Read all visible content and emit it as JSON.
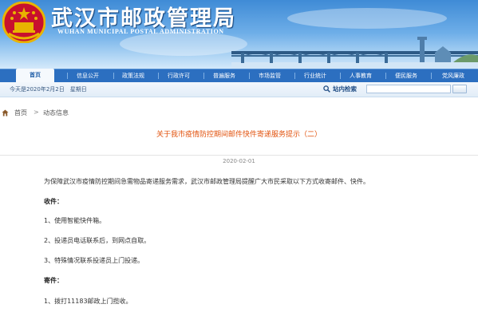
{
  "header": {
    "title_cn": "武汉市邮政管理局",
    "title_en": "WUHAN MUNICIPAL POSTAL ADMINISTRATION",
    "accent_color": "#2c6fc0"
  },
  "nav": {
    "items": [
      "首页",
      "信息公开",
      "政策法规",
      "行政许可",
      "普遍服务",
      "市场监管",
      "行业统计",
      "人事教育",
      "便民服务",
      "党风廉政"
    ],
    "active_index": 0
  },
  "infobar": {
    "date_text": "今天是2020年2月2日　星期日",
    "search_label": "站内检索",
    "search_value": ""
  },
  "breadcrumb": {
    "home": "首页",
    "separator": ">",
    "current": "动态信息"
  },
  "article": {
    "title": "关于我市疫情防控期间邮件快件寄递服务提示（二）",
    "title_color": "#e2520d",
    "date": "2020-02-01",
    "intro": "为保障武汉市疫情防控期间急需物品寄递服务需求，武汉市邮政管理局提醒广大市民采取以下方式收寄邮件、快件。",
    "receive_heading": "收件：",
    "receive_items": [
      "1、使用智能快件箱。",
      "2、投递员电话联系后，到网点自取。",
      "3、特殊情况联系投递员上门投递。"
    ],
    "send_heading": "寄件：",
    "send_items": [
      "1、拨打11183邮政上门揽收。"
    ]
  }
}
